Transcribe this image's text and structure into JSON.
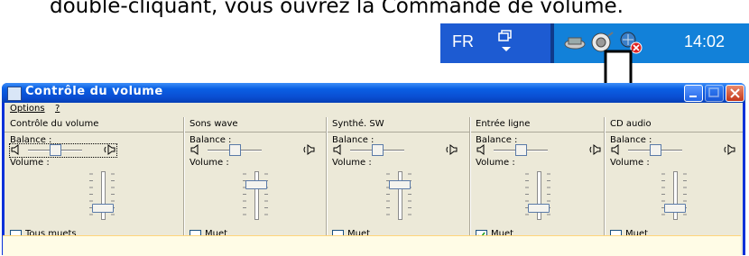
{
  "caption": "double-cliquant, vous ouvrez la Commande de volume.",
  "taskbar": {
    "language": "FR",
    "clock": "14:02"
  },
  "window": {
    "title": "Contrôle du volume",
    "menu": [
      {
        "label": "Options",
        "underline": "O"
      },
      {
        "label": "?",
        "underline": "?"
      }
    ]
  },
  "channels": [
    {
      "name": "Contrôle du volume",
      "balance_label": "Balance :",
      "volume_label": "Volume :",
      "volume_level": 0.2,
      "balance": 0.5,
      "mute_label": "Tous muets",
      "muted": false
    },
    {
      "name": "Sons wave",
      "balance_label": "Balance :",
      "volume_label": "Volume :",
      "volume_level": 0.85,
      "balance": 0.5,
      "mute_label": "Muet",
      "muted": false
    },
    {
      "name": "Synthé. SW",
      "balance_label": "Balance :",
      "volume_label": "Volume :",
      "volume_level": 0.85,
      "balance": 0.5,
      "mute_label": "Muet",
      "muted": false
    },
    {
      "name": "Entrée ligne",
      "balance_label": "Balance :",
      "volume_label": "Volume :",
      "volume_level": 0.2,
      "balance": 0.5,
      "mute_label": "Muet",
      "muted": true
    },
    {
      "name": "CD audio",
      "balance_label": "Balance :",
      "volume_label": "Volume :",
      "volume_level": 0.2,
      "balance": 0.5,
      "mute_label": "Muet",
      "muted": false
    }
  ],
  "colors": {
    "titlebar": "#0a5fe3",
    "client": "#ece9d8",
    "taskbar_tray": "#1281d9"
  }
}
